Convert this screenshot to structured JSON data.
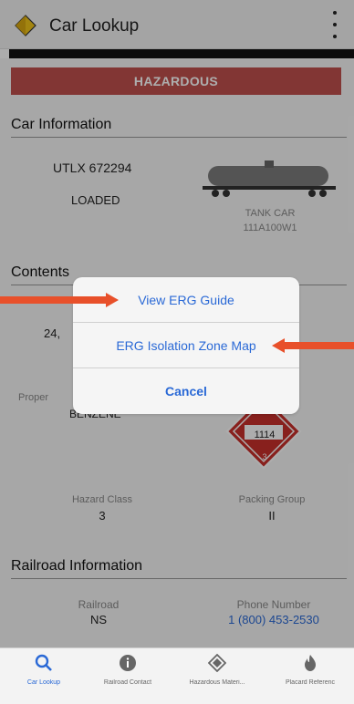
{
  "app": {
    "title": "Car Lookup"
  },
  "banner": {
    "label": "HAZARDOUS",
    "color": "#c0504d"
  },
  "car_info": {
    "header": "Car Information",
    "car_id": "UTLX 672294",
    "load_status": "LOADED",
    "car_type": "TANK CAR",
    "car_spec": "111A100W1"
  },
  "contents": {
    "header": "Contents",
    "weight_partial": "24,",
    "proper_label_partial": "Proper",
    "proper_value_partial": "BENZENE",
    "placard_number": "1114",
    "placard_class": "3",
    "hazard_class_label": "Hazard Class",
    "hazard_class_value": "3",
    "packing_group_label": "Packing Group",
    "packing_group_value": "II"
  },
  "railroad": {
    "header": "Railroad Information",
    "railroad_label": "Railroad",
    "railroad_value": "NS",
    "phone_label": "Phone Number",
    "phone_value": "1 (800) 453-2530"
  },
  "action_sheet": {
    "items": [
      {
        "label": "View ERG Guide"
      },
      {
        "label": "ERG Isolation Zone Map"
      }
    ],
    "cancel_label": "Cancel"
  },
  "tabs": [
    {
      "label": "Car Lookup",
      "icon": "search-icon",
      "active": true
    },
    {
      "label": "Railroad Contact",
      "icon": "info-icon",
      "active": false
    },
    {
      "label": "Hazardous Materi...",
      "icon": "hazmat-icon",
      "active": false
    },
    {
      "label": "Placard Referenc",
      "icon": "flame-icon",
      "active": false
    }
  ],
  "colors": {
    "accent": "#2a69d6",
    "placard_red": "#c9302c",
    "dim_overlay": "rgba(0,0,0,0.32)"
  }
}
